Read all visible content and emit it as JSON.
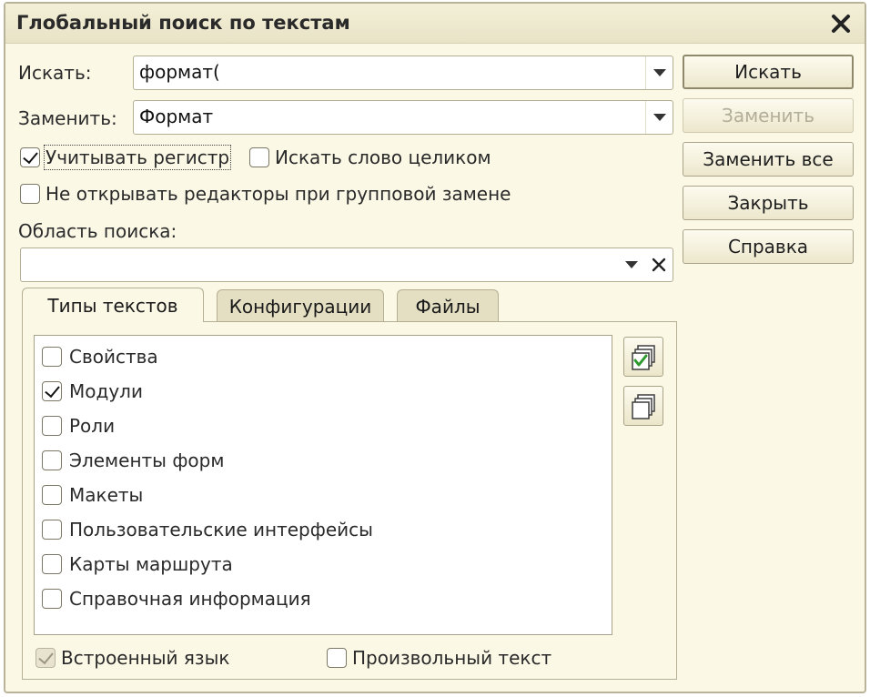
{
  "window": {
    "title": "Глобальный поиск по текстам"
  },
  "search": {
    "label": "Искать:",
    "value": "формат("
  },
  "replace": {
    "label": "Заменить:",
    "value": "Формат"
  },
  "options": {
    "match_case": {
      "label": "Учитывать регистр",
      "checked": true
    },
    "whole_word": {
      "label": "Искать слово целиком",
      "checked": false
    },
    "no_editors": {
      "label": "Не открывать редакторы при групповой замене",
      "checked": false
    }
  },
  "scope": {
    "label": "Область поиска:",
    "value": ""
  },
  "buttons": {
    "find": "Искать",
    "replace": "Заменить",
    "replace_all": "Заменить все",
    "close": "Закрыть",
    "help": "Справка"
  },
  "tabs": [
    {
      "label": "Типы текстов",
      "active": true
    },
    {
      "label": "Конфигурации",
      "active": false
    },
    {
      "label": "Файлы",
      "active": false
    }
  ],
  "text_types": [
    {
      "label": "Свойства",
      "checked": false
    },
    {
      "label": "Модули",
      "checked": true
    },
    {
      "label": "Роли",
      "checked": false
    },
    {
      "label": "Элементы форм",
      "checked": false
    },
    {
      "label": "Макеты",
      "checked": false
    },
    {
      "label": "Пользовательские интерфейсы",
      "checked": false
    },
    {
      "label": "Карты маршрута",
      "checked": false
    },
    {
      "label": "Справочная информация",
      "checked": false
    }
  ],
  "bottom": {
    "builtin_lang": {
      "label": "Встроенный язык",
      "checked": true,
      "disabled": true
    },
    "free_text": {
      "label": "Произвольный текст",
      "checked": false
    }
  },
  "icons": {
    "close": "close-icon",
    "check_all": "check-all-icon",
    "uncheck_all": "uncheck-all-icon"
  },
  "colors": {
    "background": "#fbf8e6",
    "border": "#b4ae93",
    "check_green": "#2e9a2e"
  }
}
